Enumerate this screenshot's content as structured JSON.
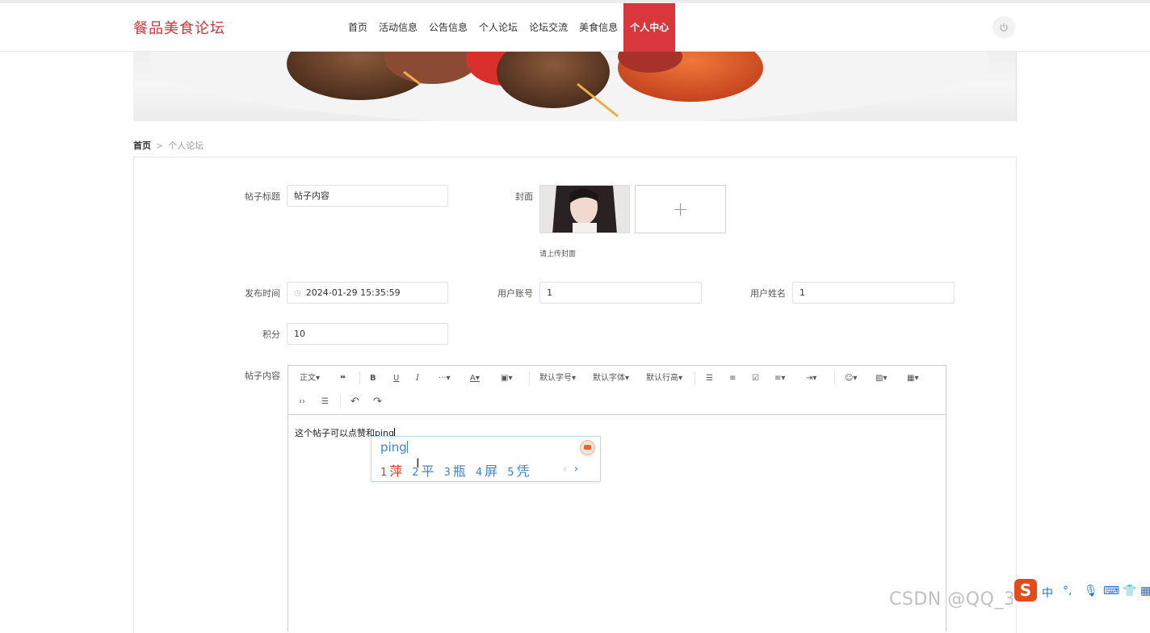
{
  "header": {
    "logo": "餐品美食论坛",
    "nav": [
      "首页",
      "活动信息",
      "公告信息",
      "个人论坛",
      "论坛交流",
      "美食信息",
      "个人中心"
    ],
    "active_nav": "个人中心",
    "power_icon": "power-icon"
  },
  "breadcrumb": {
    "home": "首页",
    "separator": ">",
    "current": "个人论坛"
  },
  "form": {
    "title_label": "帖子标题",
    "title_value": "帖子内容",
    "cover_label": "封面",
    "cover_upload_hint": "请上传封面",
    "upload_plus": "+",
    "time_label": "发布时间",
    "time_value": "2024-01-29 15:35:59",
    "account_label": "用户账号",
    "account_value": "1",
    "username_label": "用户姓名",
    "username_value": "1",
    "points_label": "积分",
    "points_value": "10",
    "content_label": "帖子内容"
  },
  "editor": {
    "toolbar": {
      "paragraph": "正文",
      "font_size": "默认字号",
      "font_family": "默认字体",
      "line_height": "默认行高"
    },
    "content": "这个帖子可以点赞和ping"
  },
  "ime": {
    "pinyin": "ping",
    "candidates": [
      {
        "num": "1",
        "char": "萍"
      },
      {
        "num": "2",
        "char": "平"
      },
      {
        "num": "3",
        "char": "瓶"
      },
      {
        "num": "4",
        "char": "屏"
      },
      {
        "num": "5",
        "char": "凭"
      }
    ],
    "prev": "‹",
    "next": "›",
    "bar_zh": "中"
  },
  "watermark": "CSDN @QQ_3786649731",
  "colors": {
    "brand": "#c8363a",
    "active_nav_bg": "#d9363e",
    "ime_blue": "#3e83c9",
    "ime_red": "#d53b28"
  }
}
